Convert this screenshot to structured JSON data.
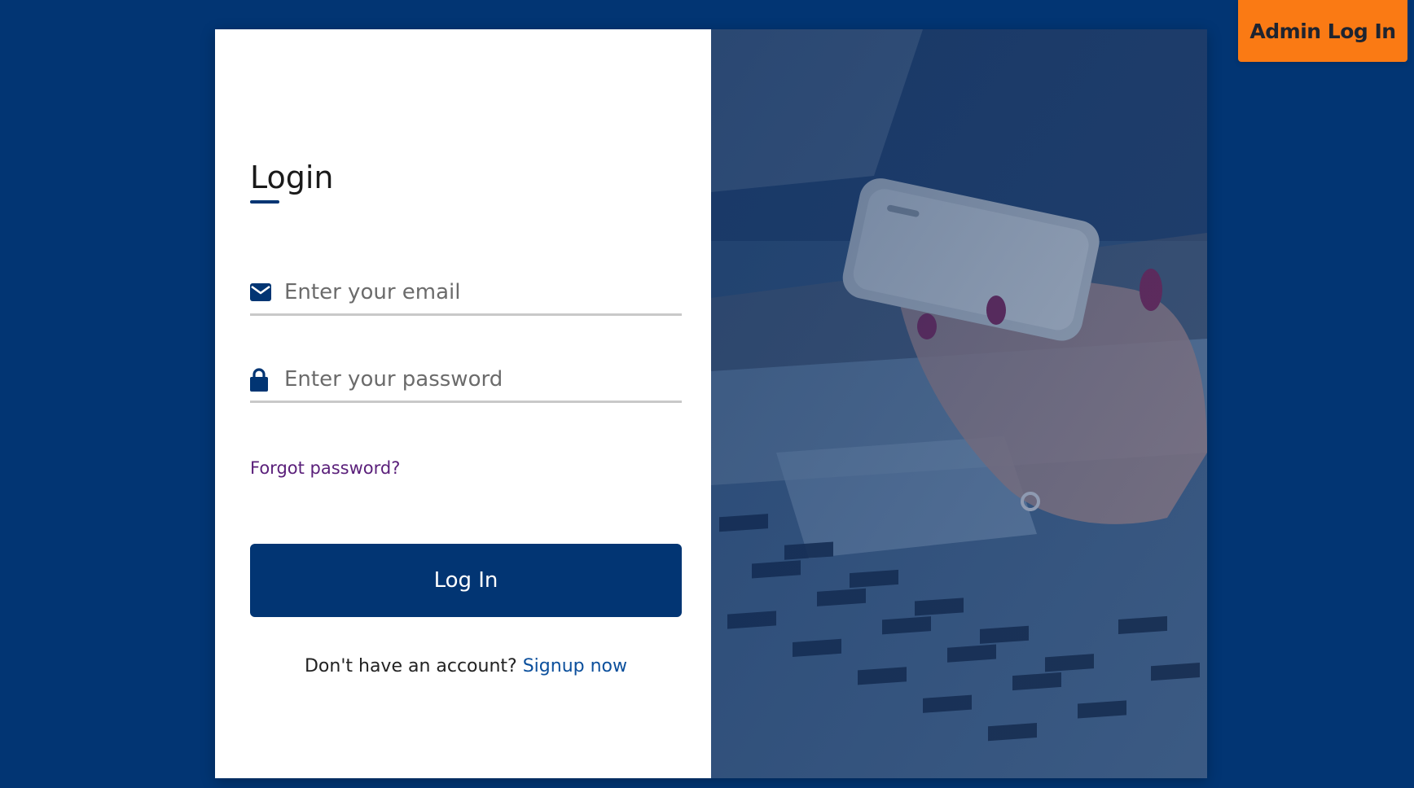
{
  "header": {
    "admin_button_label": "Admin Log In"
  },
  "login_form": {
    "title": "Login",
    "email": {
      "placeholder": "Enter your email",
      "value": "",
      "icon": "envelope-icon"
    },
    "password": {
      "placeholder": "Enter your password",
      "value": "",
      "icon": "lock-icon"
    },
    "forgot_password_link": "Forgot password?",
    "submit_label": "Log In",
    "signup_prompt": "Don't have an account?",
    "signup_link": "Signup now"
  },
  "colors": {
    "background": "#023573",
    "primary_button": "#023573",
    "admin_button": "#fa7a14",
    "forgot_link": "#5a1f7a",
    "signup_link": "#0b4f9c"
  }
}
